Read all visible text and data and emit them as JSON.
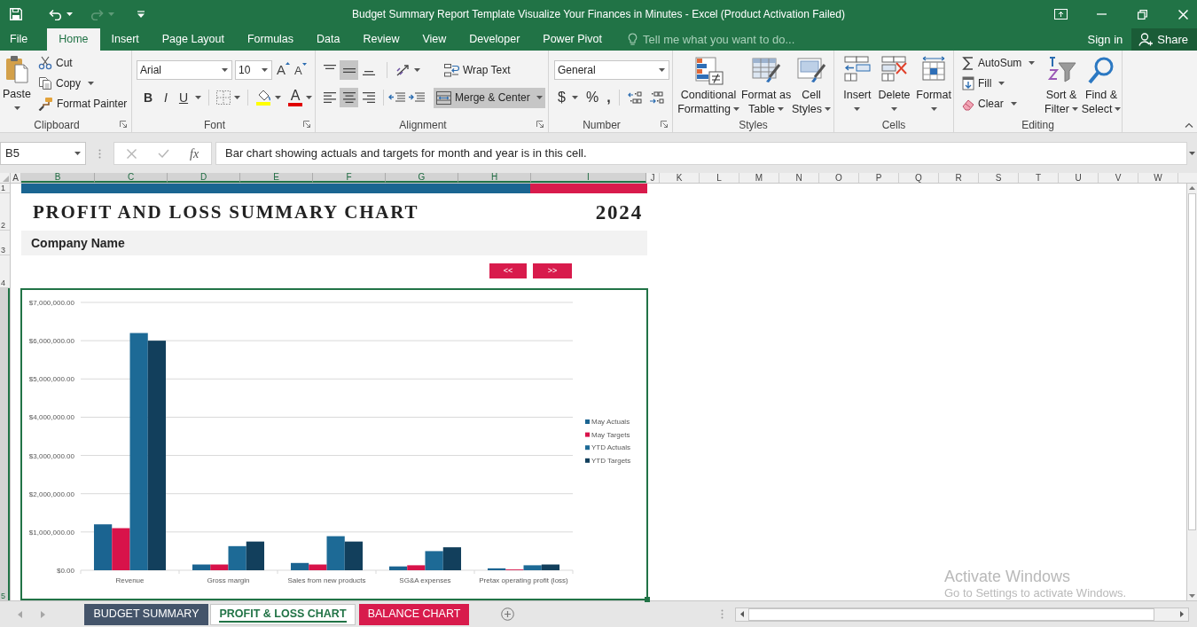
{
  "window": {
    "title": "Budget Summary Report Template Visualize Your Finances in Minutes - Excel (Product Activation Failed)"
  },
  "ribbon_tabs": [
    {
      "label": "File",
      "selected": false
    },
    {
      "label": "Home",
      "selected": true
    },
    {
      "label": "Insert",
      "selected": false
    },
    {
      "label": "Page Layout",
      "selected": false
    },
    {
      "label": "Formulas",
      "selected": false
    },
    {
      "label": "Data",
      "selected": false
    },
    {
      "label": "Review",
      "selected": false
    },
    {
      "label": "View",
      "selected": false
    },
    {
      "label": "Developer",
      "selected": false
    },
    {
      "label": "Power Pivot",
      "selected": false
    }
  ],
  "tell_me": {
    "placeholder": "Tell me what you want to do..."
  },
  "account": {
    "sign_in": "Sign in",
    "share": "Share"
  },
  "clipboard": {
    "paste": "Paste",
    "cut": "Cut",
    "copy": "Copy",
    "format_painter": "Format Painter",
    "label": "Clipboard"
  },
  "font": {
    "name": "Arial",
    "size": "10",
    "grow": "A",
    "shrink": "A",
    "styles": [
      "B",
      "I",
      "U"
    ],
    "font_color_button": "A",
    "label": "Font"
  },
  "alignment": {
    "vertical": [
      {
        "selected": false
      },
      {
        "selected": true
      },
      {
        "selected": false
      }
    ],
    "horizontal": [
      {
        "selected": false
      },
      {
        "selected": true
      },
      {
        "selected": false
      }
    ],
    "wrap_text": "Wrap Text",
    "merge_center": {
      "label": "Merge & Center",
      "selected": true
    },
    "label": "Alignment"
  },
  "number": {
    "format": "General",
    "symbols": [
      "$",
      "%",
      ","
    ],
    "label": "Number"
  },
  "styles": {
    "buttons": [
      {
        "lines": [
          "Conditional",
          "Formatting"
        ]
      },
      {
        "lines": [
          "Format as",
          "Table"
        ]
      },
      {
        "lines": [
          "Cell",
          "Styles"
        ]
      }
    ],
    "label": "Styles"
  },
  "cells": {
    "buttons": [
      "Insert",
      "Delete",
      "Format"
    ],
    "label": "Cells"
  },
  "editing": {
    "small": [
      "AutoSum",
      "Fill",
      "Clear"
    ],
    "big": [
      {
        "lines": [
          "Sort &",
          "Filter"
        ]
      },
      {
        "lines": [
          "Find &",
          "Select"
        ]
      }
    ],
    "label": "Editing"
  },
  "formula_bar": {
    "name_box": "B5",
    "insert_function": "fx",
    "formula": "Bar chart showing actuals and targets for month and year is in this cell."
  },
  "columns": [
    {
      "label": "A",
      "selected": false
    },
    {
      "label": "B",
      "selected": true
    },
    {
      "label": "C",
      "selected": true
    },
    {
      "label": "D",
      "selected": true
    },
    {
      "label": "E",
      "selected": true
    },
    {
      "label": "F",
      "selected": true
    },
    {
      "label": "G",
      "selected": true
    },
    {
      "label": "H",
      "selected": true
    },
    {
      "label": "I",
      "selected": true
    },
    {
      "label": "J",
      "selected": false
    },
    {
      "label": "K",
      "selected": false
    },
    {
      "label": "L",
      "selected": false
    },
    {
      "label": "M",
      "selected": false
    },
    {
      "label": "N",
      "selected": false
    },
    {
      "label": "O",
      "selected": false
    },
    {
      "label": "P",
      "selected": false
    },
    {
      "label": "Q",
      "selected": false
    },
    {
      "label": "R",
      "selected": false
    },
    {
      "label": "S",
      "selected": false
    },
    {
      "label": "T",
      "selected": false
    },
    {
      "label": "U",
      "selected": false
    },
    {
      "label": "V",
      "selected": false
    },
    {
      "label": "W",
      "selected": false
    }
  ],
  "rows": [
    {
      "label": "1",
      "selected": false
    },
    {
      "label": "2",
      "selected": false
    },
    {
      "label": "3",
      "selected": false
    },
    {
      "label": "4",
      "selected": false
    },
    {
      "label": "5",
      "selected": true
    }
  ],
  "sheet": {
    "title": "PROFIT AND LOSS SUMMARY CHART",
    "year": "2024",
    "company": "Company Name",
    "nav_buttons": [
      "<<",
      ">>"
    ],
    "chart_data": {
      "type": "bar",
      "categories": [
        "Revenue",
        "Gross margin",
        "Sales from new products",
        "SG&A expenses",
        "Pretax operating profit (loss)"
      ],
      "series": [
        {
          "name": "May Actuals",
          "color": "#1b6491",
          "values": [
            1200000,
            150000,
            190000,
            100000,
            50000
          ]
        },
        {
          "name": "May Targets",
          "color": "#d8134a",
          "values": [
            1100000,
            150000,
            150000,
            130000,
            20000
          ]
        },
        {
          "name": "YTD Actuals",
          "color": "#1d6a96",
          "values": [
            6200000,
            630000,
            890000,
            500000,
            130000
          ]
        },
        {
          "name": "YTD Targets",
          "color": "#123f5c",
          "values": [
            6000000,
            750000,
            750000,
            600000,
            150000
          ]
        }
      ],
      "ylim": [
        0,
        7000000
      ],
      "yticks": [
        {
          "value": 0,
          "label": "$0.00"
        },
        {
          "value": 1000000,
          "label": "$1,000,000.00"
        },
        {
          "value": 2000000,
          "label": "$2,000,000.00"
        },
        {
          "value": 3000000,
          "label": "$3,000,000.00"
        },
        {
          "value": 4000000,
          "label": "$4,000,000.00"
        },
        {
          "value": 5000000,
          "label": "$5,000,000.00"
        },
        {
          "value": 6000000,
          "label": "$6,000,000.00"
        },
        {
          "value": 7000000,
          "label": "$7,000,000.00"
        }
      ],
      "grid": true,
      "legend": "right"
    }
  },
  "sheet_tabs": [
    {
      "label": "BUDGET SUMMARY",
      "selected": false,
      "color": "#44546a"
    },
    {
      "label": "PROFIT & LOSS CHART",
      "selected": true,
      "color": "#217346"
    },
    {
      "label": "BALANCE CHART",
      "selected": false,
      "color": "#d81b4c"
    }
  ],
  "os_notice": {
    "title": "Activate Windows",
    "subtitle": "Go to Settings to activate Windows."
  }
}
